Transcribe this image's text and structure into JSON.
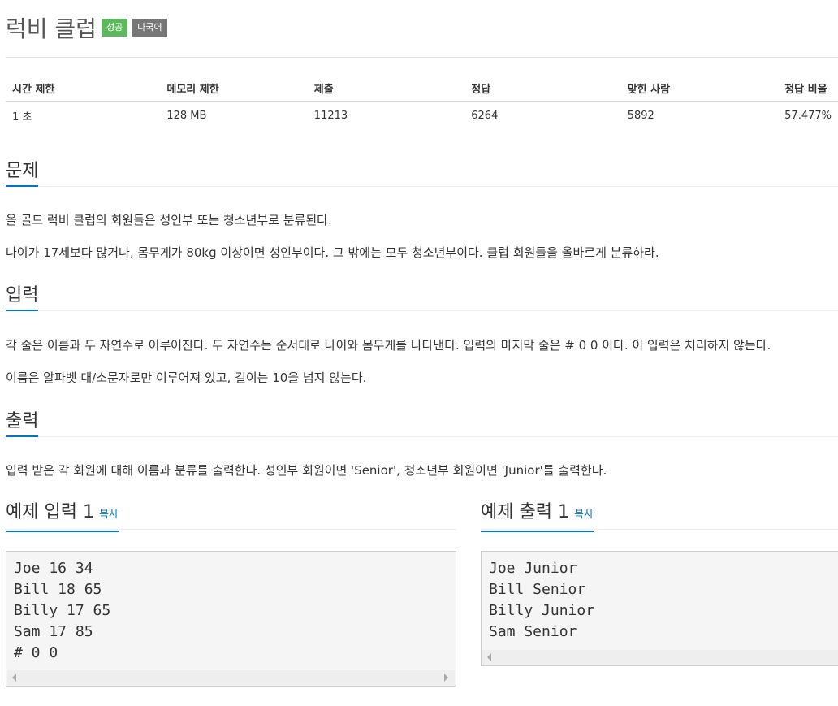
{
  "problem": {
    "title": "럭비 클럽",
    "badges": [
      "성공",
      "다국어"
    ]
  },
  "info_table": {
    "headers": [
      "시간 제한",
      "메모리 제한",
      "제출",
      "정답",
      "맞힌 사람",
      "정답 비율"
    ],
    "values": [
      "1 초",
      "128 MB",
      "11213",
      "6264",
      "5892",
      "57.477%"
    ]
  },
  "sections": {
    "description": {
      "title": "문제",
      "paragraphs": [
        "올 골드 럭비 클럽의 회원들은 성인부 또는 청소년부로 분류된다.",
        "나이가 17세보다 많거나, 몸무게가 80kg 이상이면 성인부이다. 그 밖에는 모두 청소년부이다. 클럽 회원들을 올바르게 분류하라."
      ]
    },
    "input": {
      "title": "입력",
      "paragraphs": [
        "각 줄은 이름과 두 자연수로 이루어진다. 두 자연수는 순서대로 나이와 몸무게를 나타낸다. 입력의 마지막 줄은 # 0 0 이다. 이 입력은 처리하지 않는다.",
        "이름은 알파벳 대/소문자로만 이루어져 있고, 길이는 10을 넘지 않는다."
      ]
    },
    "output": {
      "title": "출력",
      "paragraphs": [
        "입력 받은 각 회원에 대해 이름과 분류를 출력한다. 성인부 회원이면 'Senior', 청소년부 회원이면 'Junior'를 출력한다."
      ]
    }
  },
  "samples": {
    "input": {
      "title": "예제 입력 1",
      "copy_label": "복사",
      "content": "Joe 16 34\nBill 18 65\nBilly 17 65\nSam 17 85\n# 0 0"
    },
    "output": {
      "title": "예제 출력 1",
      "copy_label": "복사",
      "content": "Joe Junior\nBill Senior\nBilly Junior\nSam Senior"
    }
  },
  "colors": {
    "badge_success": "#5cb85c",
    "badge_multilang": "#777777",
    "accent": "#0076c0"
  }
}
